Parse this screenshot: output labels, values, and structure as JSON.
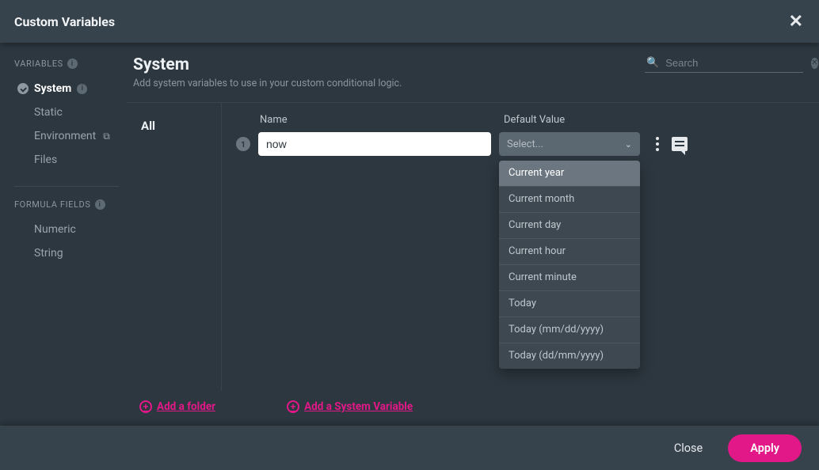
{
  "title": "Custom Variables",
  "sidebar": {
    "section_variables": {
      "label": "VARIABLES",
      "items": [
        {
          "label": "System",
          "active": true,
          "has_info": true
        },
        {
          "label": "Static",
          "active": false
        },
        {
          "label": "Environment",
          "active": false,
          "external": true
        },
        {
          "label": "Files",
          "active": false
        }
      ]
    },
    "section_formula": {
      "label": "FORMULA FIELDS",
      "items": [
        {
          "label": "Numeric",
          "active": false
        },
        {
          "label": "String",
          "active": false
        }
      ]
    }
  },
  "main": {
    "heading": "System",
    "subheading": "Add system variables to use in your custom conditional logic.",
    "search": {
      "placeholder": "Search"
    },
    "folder_tab": "All",
    "columns": {
      "name": "Name",
      "default_value": "Default Value"
    },
    "row": {
      "index": "1",
      "name_value": "now",
      "select_label": "Select...",
      "options": [
        "Current year",
        "Current month",
        "Current day",
        "Current hour",
        "Current minute",
        "Today",
        "Today (mm/dd/yyyy)",
        "Today (dd/mm/yyyy)"
      ]
    },
    "footer_links": {
      "add_folder": "Add a folder",
      "add_variable": "Add a System Variable"
    }
  },
  "footer": {
    "close": "Close",
    "apply": "Apply"
  }
}
